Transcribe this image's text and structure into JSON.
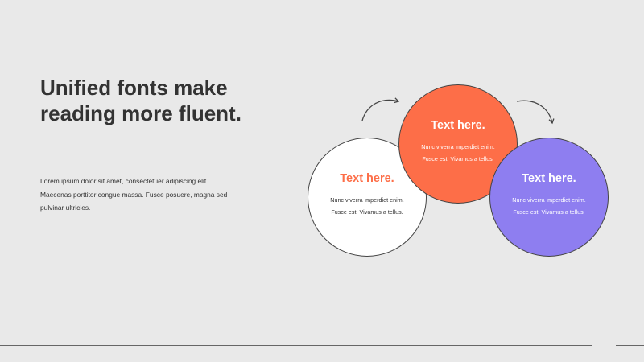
{
  "slide": {
    "title": "Unified fonts make reading more fluent.",
    "body": "Lorem ipsum dolor sit amet, consectetuer adipiscing elit. Maecenas porttitor congue massa. Fusce posuere, magna sed pulvinar ultricies."
  },
  "circles": [
    {
      "heading": "Text here.",
      "body": "Nunc viverra imperdiet enim. Fusce est. Vivamus a tellus.",
      "color": "#ffffff"
    },
    {
      "heading": "Text here.",
      "body": "Nunc viverra imperdiet enim. Fusce est. Vivamus a tellus.",
      "color": "#fd6e48"
    },
    {
      "heading": "Text here.",
      "body": "Nunc viverra imperdiet enim. Fusce est. Vivamus a tellus.",
      "color": "#8e7ef0"
    }
  ],
  "colors": {
    "background": "#e9e9e9",
    "accent_orange": "#fd6e48",
    "accent_purple": "#8e7ef0",
    "text_dark": "#333333"
  }
}
